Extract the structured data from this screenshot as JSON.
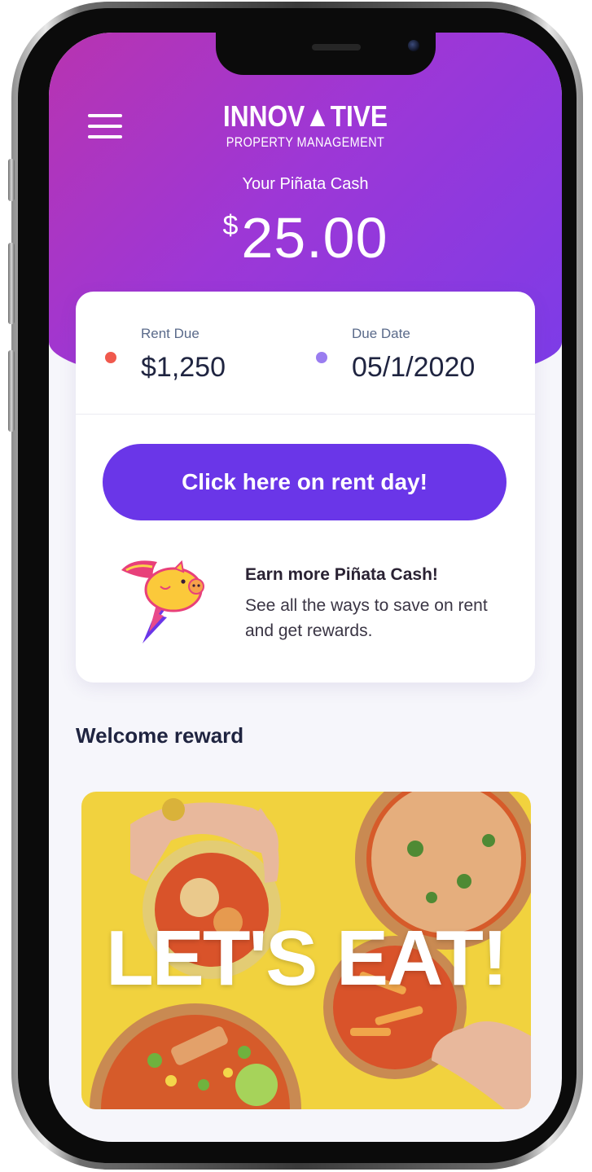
{
  "header": {
    "brand_line1": "INNOV▲TIVE",
    "brand_line2": "PROPERTY MANAGEMENT",
    "cash_label": "Your Piñata Cash",
    "cash_currency": "$",
    "cash_amount": "25.00"
  },
  "summary": {
    "rent_due_label": "Rent Due",
    "rent_due_value": "$1,250",
    "due_date_label": "Due Date",
    "due_date_value": "05/1/2020",
    "rent_dot_color": "#f0594d",
    "date_dot_color": "#9a7df0"
  },
  "cta": {
    "label": "Click here on rent day!"
  },
  "promo": {
    "title": "Earn more Piñata Cash!",
    "text": "See all the ways to save on rent and get rewards."
  },
  "reward": {
    "section_title": "Welcome reward",
    "banner_text": "LET'S EAT!"
  },
  "icons": {
    "menu": "hamburger-menu-icon",
    "promo": "flying-pig-icon"
  },
  "colors": {
    "header_start": "#b834b0",
    "header_end": "#7b3ce8",
    "cta": "#6a36e8",
    "banner_bg": "#f1d23e"
  }
}
